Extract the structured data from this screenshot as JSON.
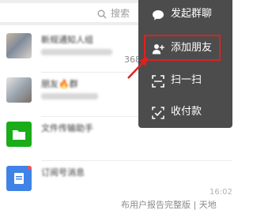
{
  "search": {
    "placeholder": "搜索"
  },
  "chat_list": {
    "rows": [
      {
        "name_blurred": "新规通知人组",
        "partial_text": "368"
      },
      {
        "name_blurred": "朋友🔥群"
      },
      {
        "name_blurred": "文件传输助手"
      },
      {
        "name_blurred": "订阅号消息",
        "time": "16:02",
        "preview": "布用户报告完整版 | 天地"
      }
    ]
  },
  "popup_menu": {
    "items": [
      {
        "label": "发起群聊",
        "icon": "chat-bubble-icon"
      },
      {
        "label": "添加朋友",
        "icon": "add-friend-icon",
        "highlighted": true
      },
      {
        "label": "扫一扫",
        "icon": "scan-icon"
      },
      {
        "label": "收付款",
        "icon": "payment-icon"
      }
    ]
  },
  "colors": {
    "popup_bg": "#4c4c4c",
    "highlight": "#e02020",
    "search_bg": "#ededed",
    "wechat_green": "#1aad19"
  }
}
